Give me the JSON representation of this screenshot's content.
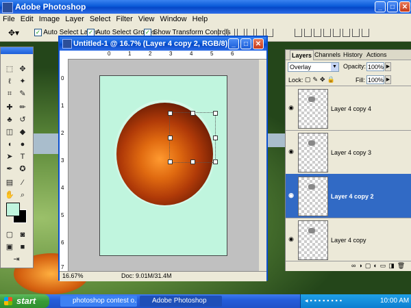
{
  "app": {
    "title": "Adobe Photoshop",
    "window_buttons": [
      "_",
      "□",
      "✕"
    ]
  },
  "menu": [
    "File",
    "Edit",
    "Image",
    "Layer",
    "Select",
    "Filter",
    "View",
    "Window",
    "Help"
  ],
  "options_bar": {
    "auto_select_layer": "Auto Select Layer",
    "auto_select_groups": "Auto Select Groups",
    "show_transform_controls": "Show Transform Controls"
  },
  "document": {
    "title": "Untitled-1 @ 16.7% (Layer 4 copy 2, RGB/8)",
    "zoom": "16.67%",
    "doc_size": "Doc: 9.01M/31.4M",
    "ruler_top": [
      "0",
      "1",
      "2",
      "3",
      "4",
      "5",
      "6"
    ],
    "ruler_left": [
      "0",
      "1",
      "2",
      "3",
      "4",
      "5",
      "6",
      "7"
    ],
    "canvas_color": "#c0f5de"
  },
  "layers_panel": {
    "tabs": [
      "Layers",
      "Channels",
      "History",
      "Actions"
    ],
    "blend_mode": "Overlay",
    "opacity_label": "Opacity:",
    "opacity_value": "100%",
    "lock_label": "Lock:",
    "fill_label": "Fill:",
    "fill_value": "100%",
    "layers": [
      {
        "name": "Layer 4 copy 4",
        "selected": false
      },
      {
        "name": "Layer 4 copy 3",
        "selected": false
      },
      {
        "name": "Layer 4 copy 2",
        "selected": true
      },
      {
        "name": "Layer 4 copy",
        "selected": false
      }
    ]
  },
  "taskbar": {
    "start": "start",
    "tasks": [
      {
        "label": "photoshop contest o...",
        "active": false
      },
      {
        "label": "Adobe Photoshop",
        "active": true
      }
    ],
    "clock": "10:00 AM"
  },
  "colors": {
    "xp_blue": "#0a5ad8",
    "selection": "#316ac5",
    "foreground_swatch": "#c0f5de",
    "background_swatch": "#000000"
  }
}
